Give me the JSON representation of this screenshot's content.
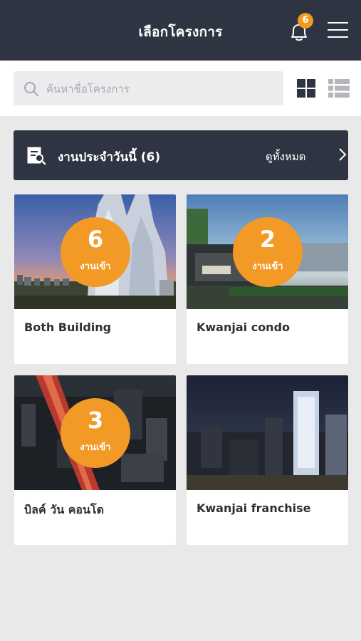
{
  "header": {
    "title": "เลือกโครงการ",
    "notification_count": "6"
  },
  "search": {
    "placeholder": "ค้นหาชื่อโครงการ"
  },
  "today_panel": {
    "label": "งานประจำวันนี้ (6)",
    "view_all": "ดูทั้งหมด"
  },
  "projects": [
    {
      "name": "Both Building",
      "badge_count": "6",
      "badge_label": "งานเข้า"
    },
    {
      "name": "Kwanjai condo",
      "badge_count": "2",
      "badge_label": "งานเข้า"
    },
    {
      "name": "บิลค์ วัน คอนโด",
      "badge_count": "3",
      "badge_label": "งานเข้า"
    },
    {
      "name": "Kwanjai franchise"
    }
  ],
  "colors": {
    "header_bg": "#2f3442",
    "accent_orange": "#f29a25",
    "page_bg": "#e9e9ea"
  }
}
